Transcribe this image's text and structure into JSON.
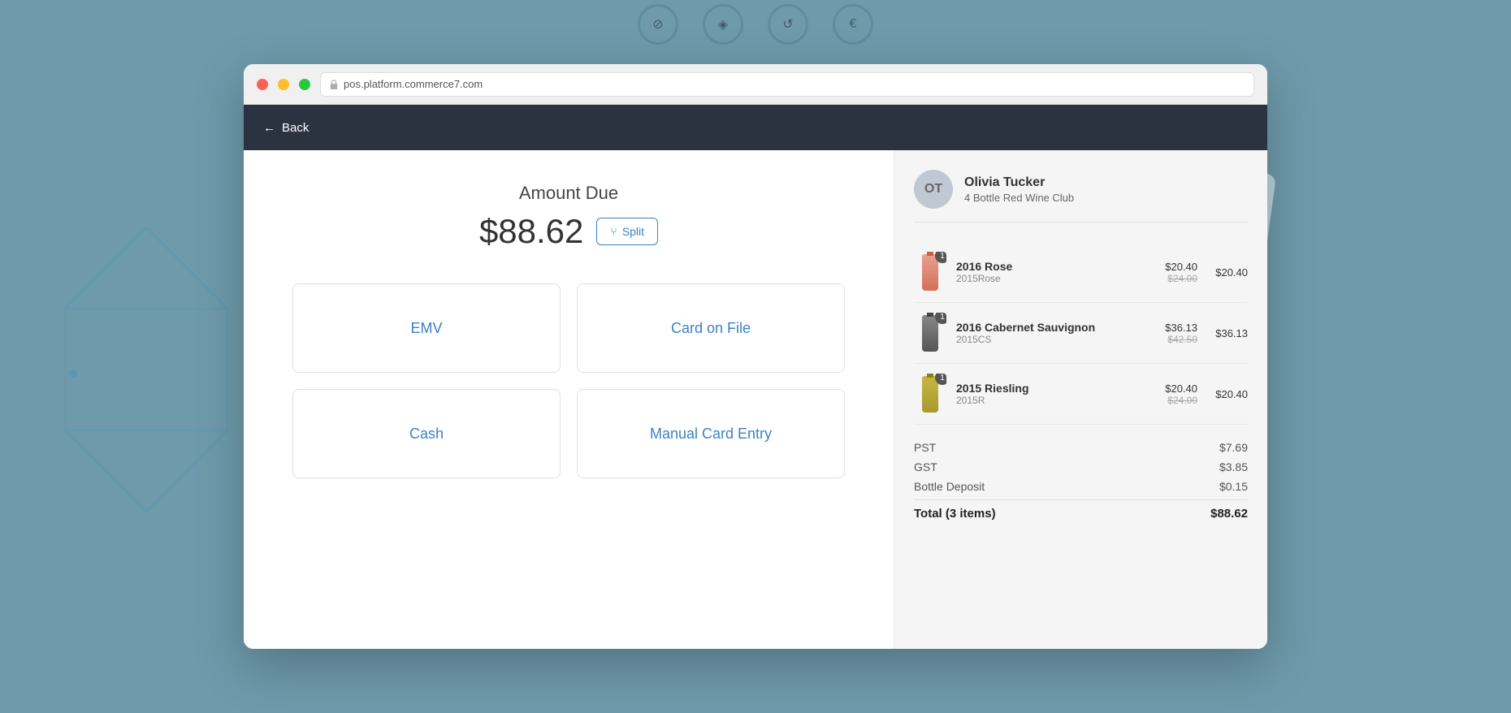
{
  "browser": {
    "address": "pos.platform.commerce7.com"
  },
  "nav": {
    "back_label": "Back"
  },
  "payment": {
    "amount_label": "Amount Due",
    "amount_value": "$88.62",
    "split_label": "Split",
    "buttons": [
      {
        "id": "emv",
        "label": "EMV"
      },
      {
        "id": "card-on-file",
        "label": "Card on File"
      },
      {
        "id": "cash",
        "label": "Cash"
      },
      {
        "id": "manual-card-entry",
        "label": "Manual Card Entry"
      }
    ]
  },
  "customer": {
    "initials": "OT",
    "name": "Olivia Tucker",
    "club": "4 Bottle Red Wine Club"
  },
  "order": {
    "items": [
      {
        "id": "rose",
        "quantity": "1",
        "name": "2016 Rose",
        "sku": "2015Rose",
        "original_price": "$24.00",
        "unit_price": "$20.40",
        "total": "$20.40",
        "bottle_type": "rose"
      },
      {
        "id": "cab",
        "quantity": "1",
        "name": "2016 Cabernet Sauvignon",
        "sku": "2015CS",
        "original_price": "$42.50",
        "unit_price": "$36.13",
        "total": "$36.13",
        "bottle_type": "cab"
      },
      {
        "id": "riesling",
        "quantity": "1",
        "name": "2015 Riesling",
        "sku": "2015R",
        "original_price": "$24.00",
        "unit_price": "$20.40",
        "total": "$20.40",
        "bottle_type": "riesling"
      }
    ],
    "totals": [
      {
        "label": "PST",
        "value": "$7.69"
      },
      {
        "label": "GST",
        "value": "$3.85"
      },
      {
        "label": "Bottle Deposit",
        "value": "$0.15"
      }
    ],
    "total_label": "Total (3 items)",
    "total_value": "$88.62"
  }
}
